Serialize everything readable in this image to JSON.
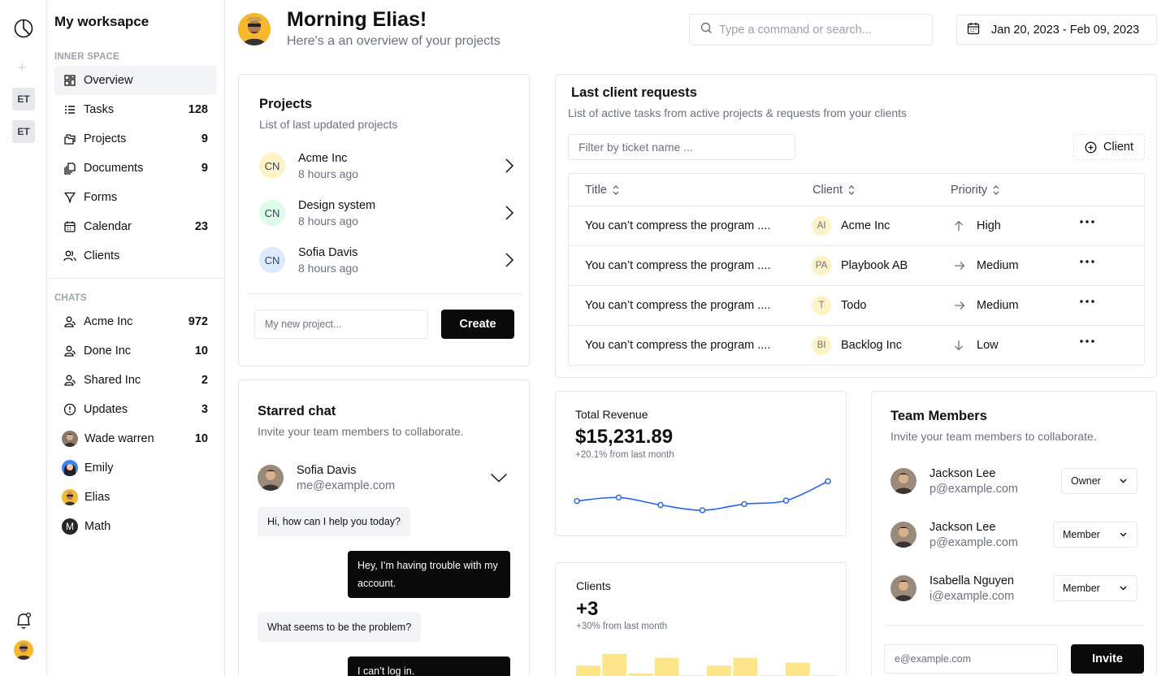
{
  "rail": {
    "workspaces": [
      "ET",
      "ET"
    ]
  },
  "sidebar": {
    "title": "My worksapce",
    "inner_label": "INNER SPACE",
    "chats_label": "CHATS",
    "inner_items": [
      {
        "label": "Overview",
        "count": "",
        "icon": "grid-icon"
      },
      {
        "label": "Tasks",
        "count": "128",
        "icon": "list-icon"
      },
      {
        "label": "Projects",
        "count": "9",
        "icon": "folder-icon"
      },
      {
        "label": "Documents",
        "count": "9",
        "icon": "documents-icon"
      },
      {
        "label": "Forms",
        "count": "",
        "icon": "filter-icon"
      },
      {
        "label": "Calendar",
        "count": "23",
        "icon": "calendar-icon"
      },
      {
        "label": "Clients",
        "count": "",
        "icon": "users-icon"
      }
    ],
    "chat_items": [
      {
        "label": "Acme Inc",
        "count": "972",
        "icon": "group-icon"
      },
      {
        "label": "Done Inc",
        "count": "10",
        "icon": "group-icon"
      },
      {
        "label": "Shared Inc",
        "count": "2",
        "icon": "group-icon"
      },
      {
        "label": "Updates",
        "count": "3",
        "icon": "info-icon"
      },
      {
        "label": "Wade warren",
        "count": "10",
        "icon": "avatar"
      },
      {
        "label": "Emily",
        "count": "",
        "icon": "avatar"
      },
      {
        "label": "Elias",
        "count": "",
        "icon": "avatar"
      },
      {
        "label": "Math",
        "count": "",
        "icon": "letter-avatar",
        "letter": "M"
      }
    ]
  },
  "header": {
    "title": "Morning Elias!",
    "subtitle": "Here's a an overview of your projects",
    "search_placeholder": "Type a command or search...",
    "date_range": "Jan 20, 2023 - Feb 09, 2023"
  },
  "projects": {
    "title": "Projects",
    "subtitle": "List of last updated projects",
    "items": [
      {
        "initials": "CN",
        "name": "Acme Inc",
        "time": "8 hours ago",
        "color": "#fef3c7"
      },
      {
        "initials": "CN",
        "name": "Design system",
        "time": "8 hours ago",
        "color": "#dcfce7"
      },
      {
        "initials": "CN",
        "name": "Sofia Davis",
        "time": "8 hours ago",
        "color": "#dbeafe"
      }
    ],
    "input_placeholder": "My new project...",
    "create_label": "Create"
  },
  "requests": {
    "title": "Last client requests",
    "subtitle": "List of active tasks from active projects & requests from your clients",
    "filter_placeholder": "Filter by ticket name ...",
    "client_button": "Client",
    "columns": [
      "Title",
      "Client",
      "Priority"
    ],
    "rows": [
      {
        "title": "You can’t compress the program ....",
        "client_initials": "AI",
        "client": "Acme Inc",
        "priority": "High",
        "direction": "up"
      },
      {
        "title": "You can’t compress the program ....",
        "client_initials": "PA",
        "client": "Playbook AB",
        "priority": "Medium",
        "direction": "right"
      },
      {
        "title": "You can’t compress the program ....",
        "client_initials": "T",
        "client": "Todo",
        "priority": "Medium",
        "direction": "right"
      },
      {
        "title": "You can’t compress the program ....",
        "client_initials": "BI",
        "client": "Backlog Inc",
        "priority": "Low",
        "direction": "down"
      }
    ]
  },
  "starred_chat": {
    "title": "Starred chat",
    "subtitle": "Invite your team members to collaborate.",
    "person": {
      "name": "Sofia Davis",
      "email": "me@example.com"
    },
    "messages": [
      {
        "from": "them",
        "text": "Hi, how can I help you today?"
      },
      {
        "from": "me",
        "text": "Hey, I’m having trouble with my account."
      },
      {
        "from": "them",
        "text": "What seems to be the problem?"
      },
      {
        "from": "me",
        "text": "I can’t log in."
      }
    ]
  },
  "revenue": {
    "label": "Total Revenue",
    "value": "$15,231.89",
    "delta": "+20.1% from last month",
    "color": "#2563eb"
  },
  "clients_card": {
    "label": "Clients",
    "value": "+3",
    "delta": "+30% from last month",
    "color": "#fde68a"
  },
  "team": {
    "title": "Team Members",
    "subtitle": "Invite your team members to collaborate.",
    "members": [
      {
        "name": "Jackson Lee",
        "email": "p@example.com",
        "role": "Owner"
      },
      {
        "name": "Jackson Lee",
        "email": "p@example.com",
        "role": "Member"
      },
      {
        "name": "Isabella Nguyen",
        "email": "i@example.com",
        "role": "Member"
      }
    ],
    "invite_placeholder": "e@example.com",
    "invite_label": "Invite"
  },
  "chart_data": [
    {
      "type": "line",
      "title": "Total Revenue",
      "x": [
        1,
        2,
        3,
        4,
        5,
        6,
        7
      ],
      "series": [
        {
          "values": [
            34,
            42,
            25,
            13,
            27,
            35,
            79
          ]
        }
      ],
      "ylim": [
        0,
        100
      ],
      "grid": false
    },
    {
      "type": "bar",
      "title": "Clients",
      "categories": [
        "1",
        "2",
        "3",
        "4",
        "5",
        "6",
        "7",
        "8",
        "9",
        "10"
      ],
      "values": [
        48,
        72,
        32,
        64,
        28,
        48,
        64,
        28,
        54,
        28
      ],
      "ylim": [
        0,
        100
      ],
      "grid": false
    }
  ]
}
